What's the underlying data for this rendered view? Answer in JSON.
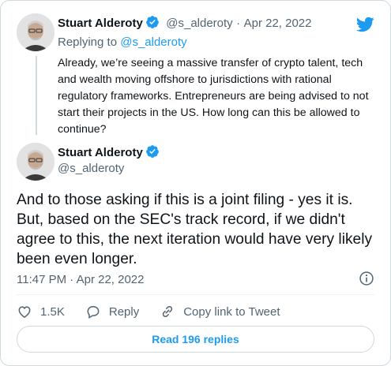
{
  "colors": {
    "accent": "#1d9bf0",
    "text_primary": "#0f1419",
    "text_secondary": "#536471",
    "border": "#cfd9de"
  },
  "quoted_tweet": {
    "author_name": "Stuart Alderoty",
    "handle": "@s_alderoty",
    "separator": "·",
    "date": "Apr 22, 2022",
    "replying_prefix": "Replying to",
    "replying_to": "@s_alderoty",
    "text": "Already, we’re seeing a massive transfer of crypto talent, tech and wealth moving offshore to jurisdictions with rational regulatory frameworks. Entrepreneurs are being advised to not start their projects in the US. How long can this be allowed to continue?"
  },
  "main_tweet": {
    "author_name": "Stuart Alderoty",
    "handle": "@s_alderoty",
    "text": "And to those asking if this is a joint filing - yes it is. But, based on the SEC's track record, if we didn't agree to this, the next iteration would have very likely been even longer.",
    "timestamp": "11:47 PM · Apr 22, 2022"
  },
  "actions": {
    "like_count": "1.5K",
    "reply_label": "Reply",
    "copy_link_label": "Copy link to Tweet"
  },
  "read_replies_label": "Read 196 replies",
  "icons": {
    "brand": "twitter-bird-icon",
    "verified": "verified-badge-icon",
    "info": "info-icon",
    "like": "heart-icon",
    "reply": "reply-bubble-icon",
    "copy_link": "link-icon"
  }
}
